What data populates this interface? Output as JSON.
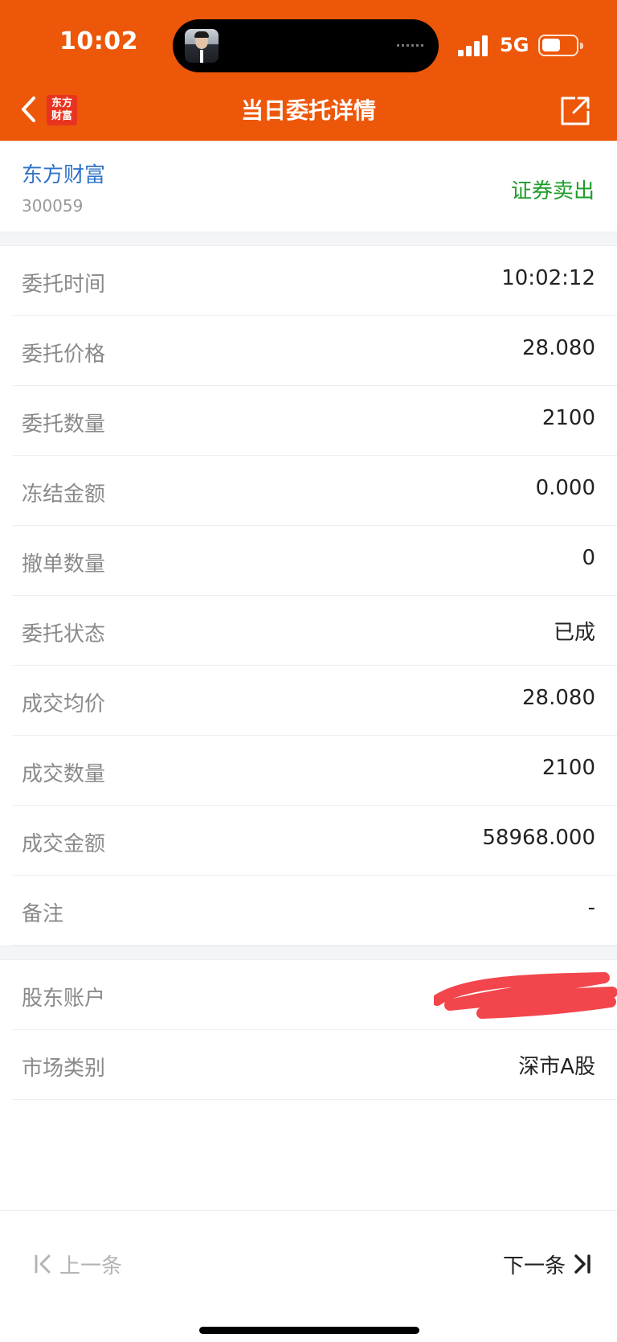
{
  "status_bar": {
    "time": "10:02",
    "network": "5G"
  },
  "nav": {
    "logo_line1": "东方",
    "logo_line2": "财富",
    "title": "当日委托详情"
  },
  "stock": {
    "name": "东方财富",
    "code": "300059",
    "trade_type": "证券卖出"
  },
  "details": [
    {
      "label": "委托时间",
      "value": "10:02:12"
    },
    {
      "label": "委托价格",
      "value": "28.080"
    },
    {
      "label": "委托数量",
      "value": "2100"
    },
    {
      "label": "冻结金额",
      "value": "0.000"
    },
    {
      "label": "撤单数量",
      "value": "0"
    },
    {
      "label": "委托状态",
      "value": "已成"
    },
    {
      "label": "成交均价",
      "value": "28.080"
    },
    {
      "label": "成交数量",
      "value": "2100"
    },
    {
      "label": "成交金额",
      "value": "58968.000"
    },
    {
      "label": "备注",
      "value": "-"
    }
  ],
  "account": [
    {
      "label": "股东账户",
      "value": ""
    },
    {
      "label": "市场类别",
      "value": "深市A股"
    }
  ],
  "footer": {
    "prev_label": "上一条",
    "next_label": "下一条"
  },
  "colors": {
    "brand_orange": "#ed5709",
    "stock_name_blue": "#2f73c8",
    "sell_green": "#1e9c2a",
    "redaction_red": "#f2464c"
  },
  "icons": {
    "back": "chevron-left-icon",
    "share": "share-icon",
    "prev": "first-page-icon",
    "next": "last-page-icon"
  }
}
